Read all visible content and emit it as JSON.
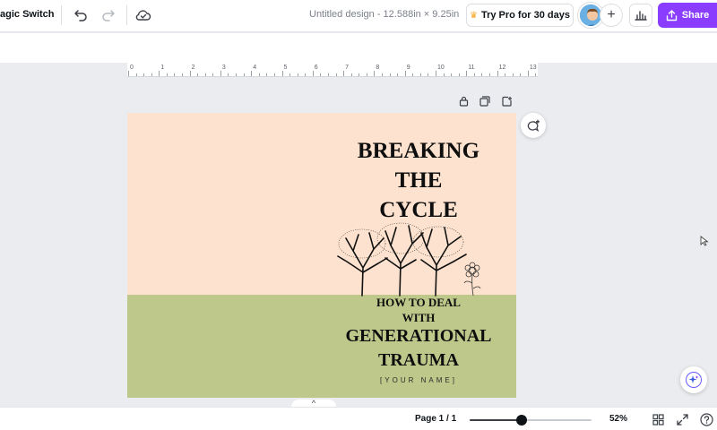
{
  "topbar": {
    "magic_switch_label": "agic Switch",
    "undo_icon": "undo-icon",
    "redo_icon": "redo-icon",
    "cloud_icon": "cloud-saved-icon",
    "doc_title": "Untitled design - 12.588in × 9.25in",
    "pro_label": "Try Pro for 30 days",
    "share_label": "Share"
  },
  "ruler": {
    "numbers": [
      "0",
      "1",
      "2",
      "3",
      "4",
      "5",
      "6",
      "7",
      "8",
      "9",
      "10",
      "11",
      "12",
      "13"
    ]
  },
  "design": {
    "title_lines": [
      "BREAKING",
      "THE",
      "CYCLE"
    ],
    "subtitle_lines": [
      "HOW TO DEAL",
      "WITH"
    ],
    "headline_lines": [
      "GENERATIONAL",
      "TRAUMA"
    ],
    "author": "[YOUR NAME]",
    "colors": {
      "sky": "#fde3cf",
      "ground": "#bec88b",
      "text": "#0e0e0e"
    }
  },
  "bottombar": {
    "page_indicator": "Page 1 / 1",
    "zoom_percent": 52,
    "zoom_label": "52%",
    "notes_chevron": "^"
  },
  "colors": {
    "accent": "#8b3dff",
    "crown": "#f5a623"
  }
}
